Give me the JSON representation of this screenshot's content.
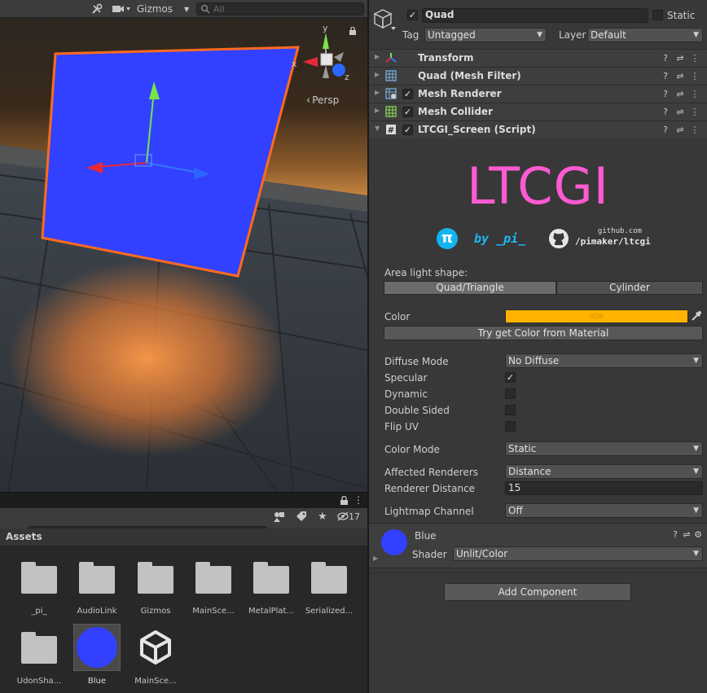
{
  "scene": {
    "toolbar": {
      "gizmos_label": "Gizmos",
      "search_placeholder": "All"
    },
    "view_label": "Persp",
    "axis_labels": {
      "x": "x",
      "y": "y",
      "z": "z"
    }
  },
  "project": {
    "hidden_count": "17",
    "header": "Assets",
    "items": [
      {
        "label": "_pi_",
        "kind": "folder"
      },
      {
        "label": "AudioLink",
        "kind": "folder"
      },
      {
        "label": "Gizmos",
        "kind": "folder"
      },
      {
        "label": "MainSce...",
        "kind": "folder"
      },
      {
        "label": "MetalPlat...",
        "kind": "folder"
      },
      {
        "label": "Serialized...",
        "kind": "folder"
      },
      {
        "label": "UdonSha...",
        "kind": "folder"
      },
      {
        "label": "Blue",
        "kind": "material",
        "selected": true
      },
      {
        "label": "MainSce...",
        "kind": "unity-scene"
      }
    ]
  },
  "inspector": {
    "object": {
      "name": "Quad",
      "active": true,
      "static_label": "Static",
      "static": false,
      "tag_label": "Tag",
      "tag_value": "Untagged",
      "layer_label": "Layer",
      "layer_value": "Default"
    },
    "components": [
      {
        "name": "Transform",
        "icon": "transform-icon",
        "has_checkbox": false,
        "expanded": false
      },
      {
        "name": "Quad (Mesh Filter)",
        "icon": "mesh-filter-icon",
        "has_checkbox": false,
        "expanded": false
      },
      {
        "name": "Mesh Renderer",
        "icon": "mesh-renderer-icon",
        "has_checkbox": true,
        "expanded": false
      },
      {
        "name": "Mesh Collider",
        "icon": "mesh-collider-icon",
        "has_checkbox": true,
        "expanded": false
      },
      {
        "name": "LTCGI_Screen (Script)",
        "icon": "script-icon",
        "has_checkbox": true,
        "expanded": true
      }
    ],
    "ltcgi": {
      "logo": "LTCGI",
      "by_text": "by _pi_",
      "github_line1": "github.com",
      "github_line2": "/pimaker/ltcgi",
      "area_shape_label": "Area light shape:",
      "shape_options": [
        "Quad/Triangle",
        "Cylinder"
      ],
      "shape_selected": 0,
      "color_label": "Color",
      "color_value": "#ffb300",
      "color_hdr_text": "HDR",
      "try_color_button": "Try get Color from Material",
      "diffuse_mode_label": "Diffuse Mode",
      "diffuse_mode_value": "No Diffuse",
      "specular_label": "Specular",
      "specular": true,
      "dynamic_label": "Dynamic",
      "dynamic": false,
      "double_sided_label": "Double Sided",
      "double_sided": false,
      "flip_uv_label": "Flip UV",
      "flip_uv": false,
      "color_mode_label": "Color Mode",
      "color_mode_value": "Static",
      "affected_renderers_label": "Affected Renderers",
      "affected_renderers_value": "Distance",
      "renderer_distance_label": "Renderer Distance",
      "renderer_distance_value": "15",
      "lightmap_channel_label": "Lightmap Channel",
      "lightmap_channel_value": "Off"
    },
    "material": {
      "name": "Blue",
      "swatch_color": "#3241ff",
      "shader_label": "Shader",
      "shader_value": "Unlit/Color"
    },
    "add_component_button": "Add Component"
  },
  "colors": {
    "quad_blue": "#3241ff",
    "selection_outline": "#ff6a1f",
    "logo_pink": "#ff5ad2",
    "pi_cyan": "#14b4f0",
    "floor_glow": "#ff8c3c"
  }
}
